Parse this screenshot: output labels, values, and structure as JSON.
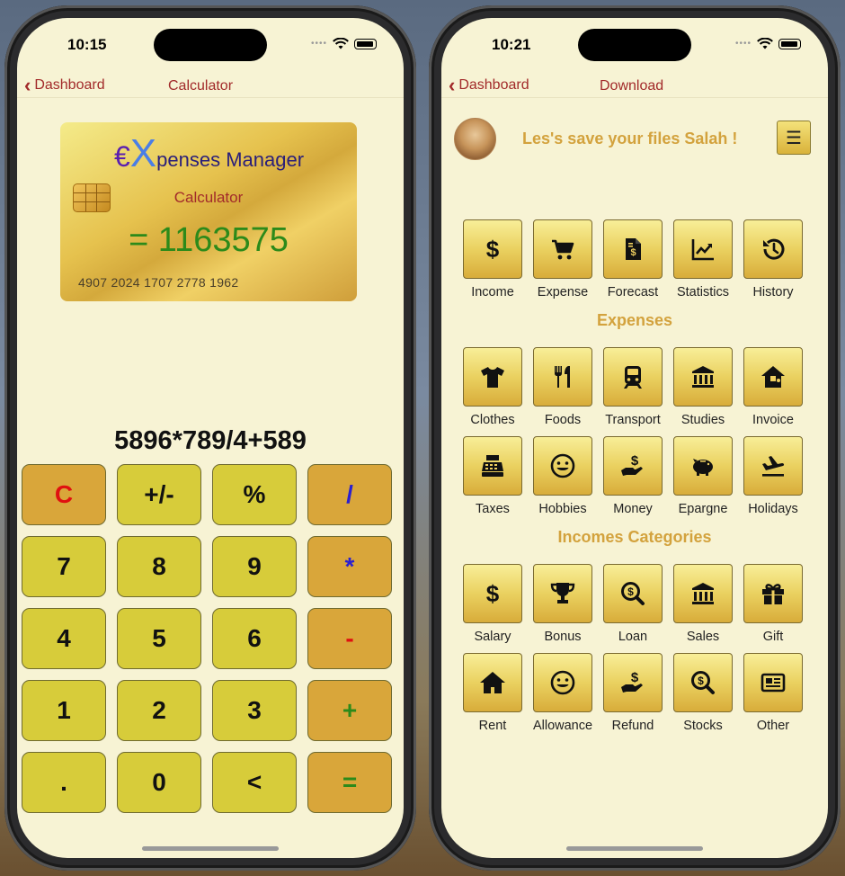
{
  "left": {
    "status_time": "10:15",
    "nav_back": "Dashboard",
    "nav_title": "Calculator",
    "card": {
      "logo_euro": "€",
      "logo_x": "X",
      "logo_rest": "penses Manager",
      "subtitle": "Calculator",
      "result": "= 1163575",
      "card_number": "4907 2024 1707 2778 1962"
    },
    "expression": "5896*789/4+589",
    "keys": [
      {
        "label": "C",
        "color": "#e01010",
        "op": true
      },
      {
        "label": "+/-",
        "color": "#111111",
        "op": false
      },
      {
        "label": "%",
        "color": "#111111",
        "op": false
      },
      {
        "label": "/",
        "color": "#2a1fd0",
        "op": true
      },
      {
        "label": "7",
        "color": "#111111",
        "op": false
      },
      {
        "label": "8",
        "color": "#111111",
        "op": false
      },
      {
        "label": "9",
        "color": "#111111",
        "op": false
      },
      {
        "label": "*",
        "color": "#2a1fd0",
        "op": true
      },
      {
        "label": "4",
        "color": "#111111",
        "op": false
      },
      {
        "label": "5",
        "color": "#111111",
        "op": false
      },
      {
        "label": "6",
        "color": "#111111",
        "op": false
      },
      {
        "label": "-",
        "color": "#e01010",
        "op": true
      },
      {
        "label": "1",
        "color": "#111111",
        "op": false
      },
      {
        "label": "2",
        "color": "#111111",
        "op": false
      },
      {
        "label": "3",
        "color": "#111111",
        "op": false
      },
      {
        "label": "+",
        "color": "#2c8a1a",
        "op": true
      },
      {
        "label": ".",
        "color": "#111111",
        "op": false
      },
      {
        "label": "0",
        "color": "#111111",
        "op": false
      },
      {
        "label": "<",
        "color": "#111111",
        "op": false
      },
      {
        "label": "=",
        "color": "#2c8a1a",
        "op": true
      }
    ]
  },
  "right": {
    "status_time": "10:21",
    "nav_back": "Dashboard",
    "nav_title": "Download",
    "greeting": "Les's save your files Salah !",
    "menu_icon": "☰",
    "top_row": [
      {
        "label": "Income",
        "icon": "dollar-icon"
      },
      {
        "label": "Expense",
        "icon": "cart-icon"
      },
      {
        "label": "Forecast",
        "icon": "invoice-file-icon"
      },
      {
        "label": "Statistics",
        "icon": "chart-icon"
      },
      {
        "label": "History",
        "icon": "history-icon"
      }
    ],
    "expenses_title": "Expenses",
    "expenses_row1": [
      {
        "label": "Clothes",
        "icon": "tshirt-icon"
      },
      {
        "label": "Foods",
        "icon": "utensils-icon"
      },
      {
        "label": "Transport",
        "icon": "train-icon"
      },
      {
        "label": "Studies",
        "icon": "bank-icon"
      },
      {
        "label": "Invoice",
        "icon": "house-icon"
      }
    ],
    "expenses_row2": [
      {
        "label": "Taxes",
        "icon": "cash-register-icon"
      },
      {
        "label": "Hobbies",
        "icon": "smile-icon"
      },
      {
        "label": "Money",
        "icon": "hand-dollar-icon"
      },
      {
        "label": "Epargne",
        "icon": "piggy-bank-icon"
      },
      {
        "label": "Holidays",
        "icon": "plane-icon"
      }
    ],
    "incomes_title": "Incomes Categories",
    "incomes_row1": [
      {
        "label": "Salary",
        "icon": "dollar-icon"
      },
      {
        "label": "Bonus",
        "icon": "trophy-icon"
      },
      {
        "label": "Loan",
        "icon": "search-dollar-icon"
      },
      {
        "label": "Sales",
        "icon": "bank-icon"
      },
      {
        "label": "Gift",
        "icon": "gift-icon"
      }
    ],
    "incomes_row2": [
      {
        "label": "Rent",
        "icon": "home-icon"
      },
      {
        "label": "Allowance",
        "icon": "smile-icon"
      },
      {
        "label": "Refund",
        "icon": "hand-dollar-icon"
      },
      {
        "label": "Stocks",
        "icon": "search-dollar-icon"
      },
      {
        "label": "Other",
        "icon": "newspaper-icon"
      }
    ]
  }
}
